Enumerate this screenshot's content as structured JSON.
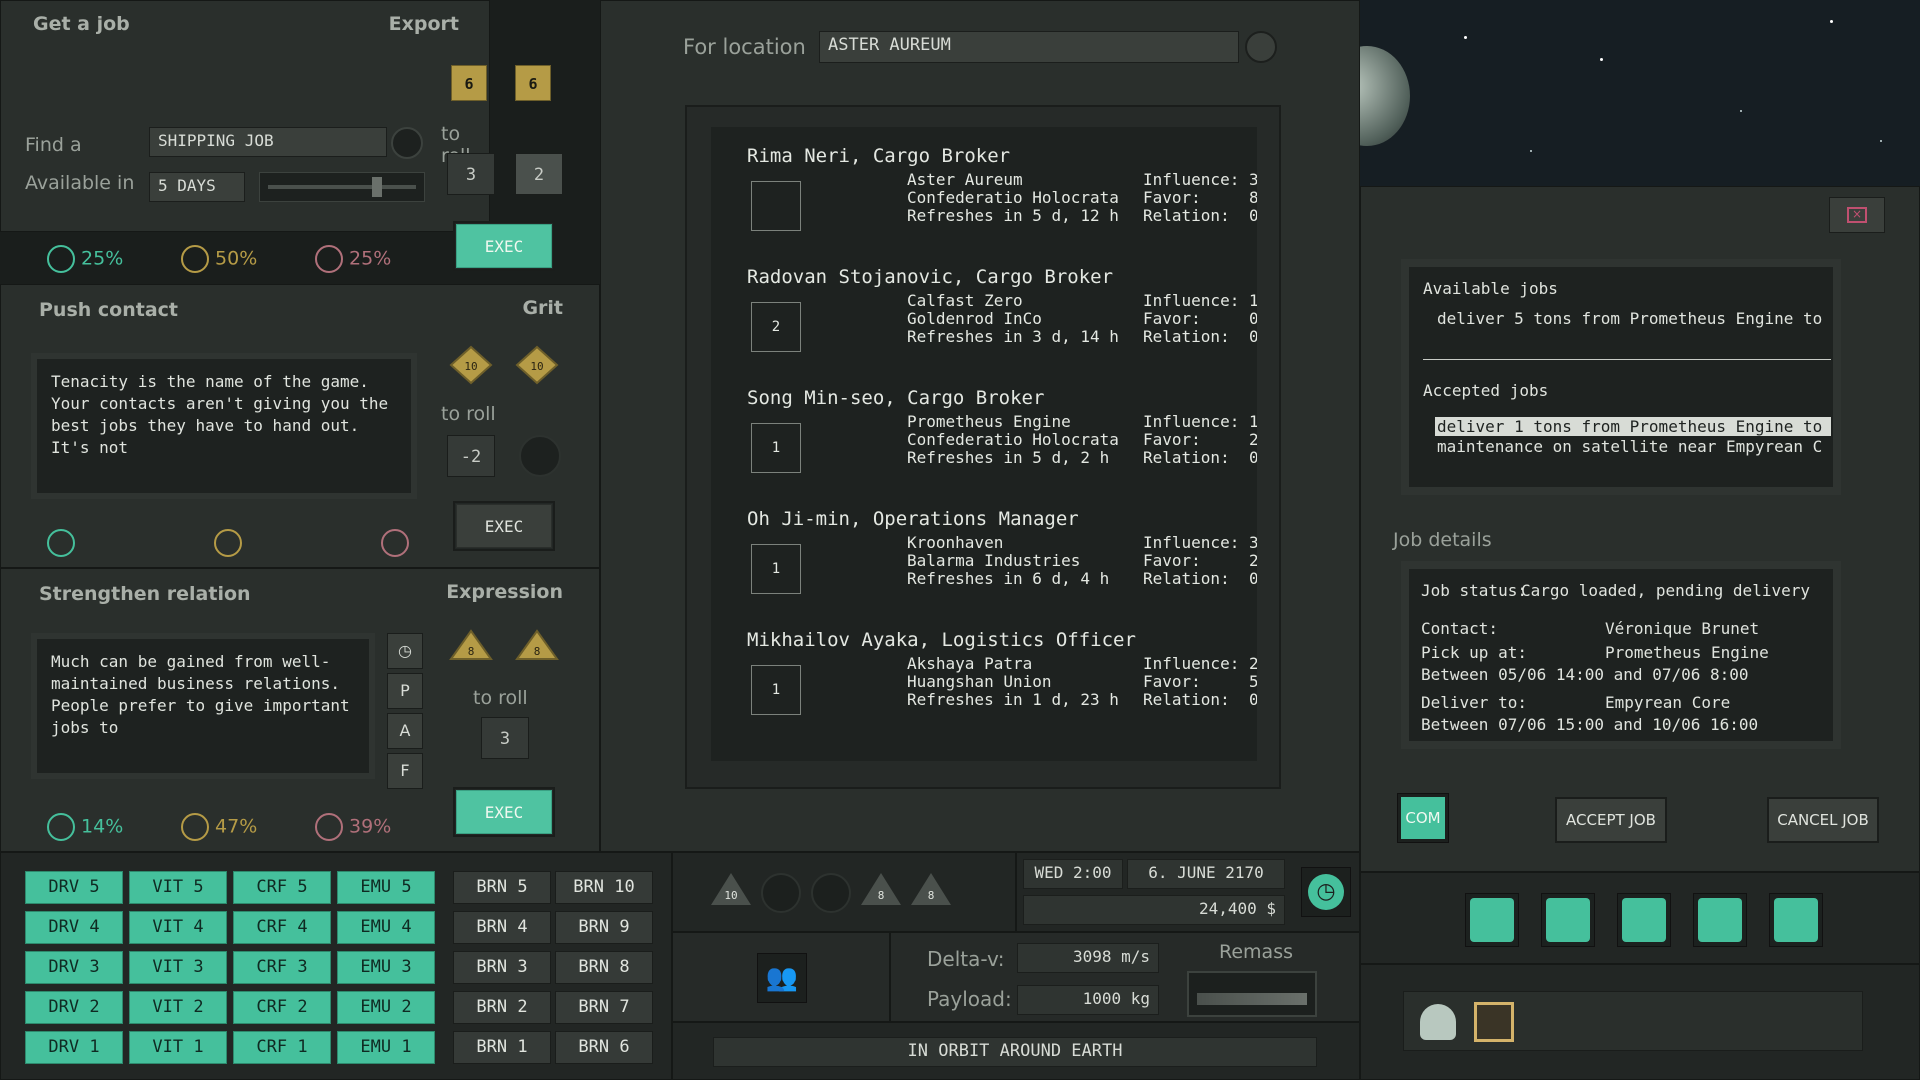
{
  "get_job": {
    "title": "Get a job",
    "export_label": "Export",
    "export_values": [
      "6",
      "6"
    ],
    "find_label": "Find a",
    "find_value": "SHIPPING JOB",
    "available_label": "Available in",
    "available_value": "5 DAYS",
    "slider_level": 0.75,
    "to_roll_label": "to roll",
    "roll_values": [
      "3",
      "2"
    ],
    "exec_label": "EXEC",
    "odds": [
      "25%",
      "50%",
      "25%"
    ]
  },
  "push_contact": {
    "title": "Push contact",
    "grit_label": "Grit",
    "dice": [
      "10",
      "10"
    ],
    "to_roll_label": "to roll",
    "roll_value": "-2",
    "description": "Tenacity is the name of the game. Your contacts aren't giving you the best jobs they have to hand out. It's not",
    "exec_label": "EXEC"
  },
  "strengthen": {
    "title": "Strengthen relation",
    "expression_label": "Expression",
    "dice": [
      "8",
      "8"
    ],
    "to_roll_label": "to roll",
    "roll_value": "3",
    "description": "Much can be gained from well-maintained business relations. People prefer to give important jobs to",
    "side_buttons": [
      "P",
      "A",
      "F"
    ],
    "exec_label": "EXEC",
    "odds": [
      "14%",
      "47%",
      "39%"
    ]
  },
  "location": {
    "label": "For location",
    "value": "ASTER AUREUM"
  },
  "contacts": [
    {
      "name": "Rima Neri, Cargo Broker",
      "lines": "Aster Aureum\nConfederatio Holocrata\nRefreshes in 5 d, 12 h",
      "stats": "Influence: 3\nFavor:     8\nRelation:  0",
      "badge": ""
    },
    {
      "name": "Radovan Stojanovic, Cargo Broker",
      "lines": "Calfast Zero\nGoldenrod InCo\nRefreshes in 3 d, 14 h",
      "stats": "Influence: 1\nFavor:     0\nRelation:  0",
      "badge": "2"
    },
    {
      "name": "Song Min-seo, Cargo Broker",
      "lines": "Prometheus Engine\nConfederatio Holocrata\nRefreshes in 5 d, 2 h",
      "stats": "Influence: 1\nFavor:     2\nRelation:  0",
      "badge": "1"
    },
    {
      "name": "Oh Ji-min, Operations Manager",
      "lines": "Kroonhaven\nBalarma Industries\nRefreshes in 6 d, 4 h",
      "stats": "Influence: 3\nFavor:     2\nRelation:  0",
      "badge": "1"
    },
    {
      "name": "Mikhailov Ayaka, Logistics Officer",
      "lines": "Akshaya Patra\nHuangshan Union\nRefreshes in 1 d, 23 h",
      "stats": "Influence: 2\nFavor:     5\nRelation:  0",
      "badge": "1"
    }
  ],
  "jobs": {
    "available_title": "Available jobs",
    "available": [
      "deliver 5 tons from Prometheus Engine to"
    ],
    "accepted_title": "Accepted jobs",
    "accepted": [
      "deliver 1 tons from Prometheus Engine to",
      "maintenance on satellite near Empyrean C"
    ]
  },
  "job_details": {
    "title": "Job details",
    "status_label": "Job status:",
    "status_value": "Cargo loaded, pending delivery",
    "contact_label": "Contact:",
    "contact_value": "Véronique Brunet",
    "pickup_label": "Pick up at:",
    "pickup_value": "Prometheus Engine",
    "pickup_window": "Between 05/06 14:00 and 07/06 8:00",
    "deliver_label": "Deliver to:",
    "deliver_value": "Empyrean Core",
    "deliver_window": "Between 07/06 15:00 and 10/06 16:00"
  },
  "job_buttons": {
    "com": "COM",
    "accept": "ACCEPT JOB",
    "cancel": "CANCEL JOB"
  },
  "skills": {
    "drv": [
      "DRV 5",
      "DRV 4",
      "DRV 3",
      "DRV 2",
      "DRV 1"
    ],
    "vit": [
      "VIT 5",
      "VIT 4",
      "VIT 3",
      "VIT 2",
      "VIT 1"
    ],
    "crf": [
      "CRF 5",
      "CRF 4",
      "CRF 3",
      "CRF 2",
      "CRF 1"
    ],
    "emu": [
      "EMU 5",
      "EMU 4",
      "EMU 3",
      "EMU 2",
      "EMU 1"
    ],
    "brn_a": [
      "BRN 5",
      "BRN 4",
      "BRN 3",
      "BRN 2",
      "BRN 1"
    ],
    "brn_b": [
      "BRN 10",
      "BRN 9",
      "BRN 8",
      "BRN 7",
      "BRN 6"
    ]
  },
  "dice_tray": [
    "10",
    "",
    "",
    "8",
    "8"
  ],
  "status": {
    "time": "WED 2:00",
    "date": "6. JUNE 2170",
    "money": "24,400 $",
    "delta_v_label": "Delta-v:",
    "delta_v": "3098 m/s",
    "payload_label": "Payload:",
    "payload": "1000 kg",
    "remass_label": "Remass",
    "orbit": "IN ORBIT AROUND EARTH"
  },
  "colors": {
    "accent": "#45c09c",
    "panel": "#2a2f2c",
    "close": "#c05070"
  },
  "icons": [
    "contract-icon",
    "gear-icon",
    "cargo-icon",
    "radar-icon",
    "person-icon",
    "person-star-icon",
    "box-icon",
    "clock-icon",
    "crew-icon",
    "close-icon",
    "search-icon"
  ]
}
